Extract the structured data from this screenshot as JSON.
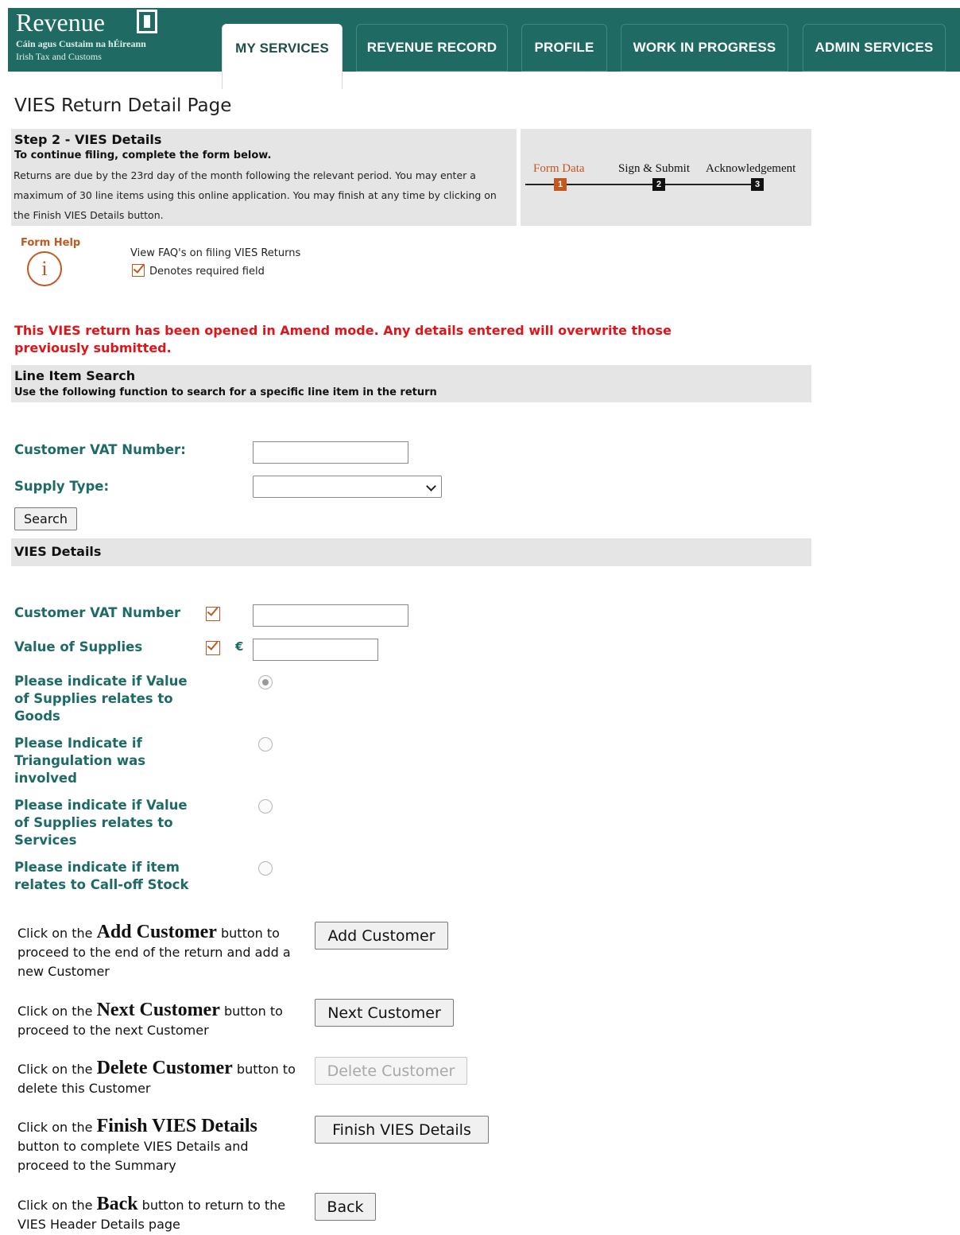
{
  "header": {
    "logo_title": "Revenue",
    "logo_sub1": "Cáin agus Custaim na hÉireann",
    "logo_sub2": "Irish Tax and Customs",
    "tabs": [
      {
        "label": "MY SERVICES",
        "active": true
      },
      {
        "label": "REVENUE RECORD",
        "active": false
      },
      {
        "label": "PROFILE",
        "active": false
      },
      {
        "label": "WORK IN PROGRESS",
        "active": false
      },
      {
        "label": "ADMIN SERVICES",
        "active": false
      }
    ],
    "brand_color": "#1f6b63"
  },
  "page_title": "VIES Return Detail Page",
  "step": {
    "title": "Step 2 - VIES Details",
    "subtitle": "To continue filing, complete the form below.",
    "text": "Returns are due by the 23rd day of the month following the relevant period. You may enter a maximum of 30 line items using this online application. You may finish at any time by clicking on the Finish VIES Details button."
  },
  "progress": {
    "steps": [
      {
        "label": "Form Data",
        "number": "1",
        "current": true
      },
      {
        "label": "Sign & Submit",
        "number": "2",
        "current": false
      },
      {
        "label": "Acknowledgement",
        "number": "3",
        "current": false
      }
    ]
  },
  "help": {
    "label": "Form Help",
    "icon": "info-icon",
    "faq_link": "View FAQ's on filing VIES Returns",
    "required_note": "Denotes required field"
  },
  "warning": "This VIES return has been opened in Amend mode. Any details entered will overwrite those previously submitted.",
  "line_item_search": {
    "title": "Line Item Search",
    "subtitle": "Use the following function to search for a specific line item in the return",
    "customer_vat_label": "Customer VAT Number:",
    "customer_vat_value": "",
    "supply_type_label": "Supply Type:",
    "supply_type_value": "",
    "search_button": "Search"
  },
  "vies_details": {
    "title": "VIES Details",
    "customer_vat_label": "Customer VAT Number",
    "customer_vat_value": "",
    "value_label": "Value of Supplies",
    "currency": "€",
    "value_value": "",
    "goods_label": "Please indicate if Value of Supplies relates to Goods",
    "goods_checked": true,
    "triangulation_label": "Please Indicate if Triangulation was involved",
    "triangulation_checked": false,
    "services_label": "Please indicate if Value of Supplies relates to Services",
    "services_checked": false,
    "calloff_label": "Please indicate if item relates to Call-off Stock",
    "calloff_checked": false
  },
  "actions": [
    {
      "pre": "Click on the ",
      "keyword": "Add Customer",
      "post": " button to proceed to the end of the return and add a new Customer",
      "button": "Add Customer",
      "disabled": false
    },
    {
      "pre": "Click on the ",
      "keyword": "Next Customer",
      "post": " button to proceed to the next Customer",
      "button": "Next Customer",
      "disabled": false
    },
    {
      "pre": "Click on the ",
      "keyword": "Delete Customer",
      "post": " button to delete this Customer",
      "button": "Delete Customer",
      "disabled": true
    },
    {
      "pre": "Click on the ",
      "keyword": "Finish VIES Details",
      "post": " button to complete VIES Details and proceed to the Summary",
      "button": "Finish VIES Details",
      "disabled": false
    },
    {
      "pre": "Click on the ",
      "keyword": "Back",
      "post": " button to return to the VIES Header Details page",
      "button": "Back",
      "disabled": false
    }
  ],
  "colors": {
    "label_teal": "#1e6b66",
    "warning_red": "#e0151a",
    "accent_orange": "#c2571f",
    "section_gray": "#e5e5e5"
  }
}
